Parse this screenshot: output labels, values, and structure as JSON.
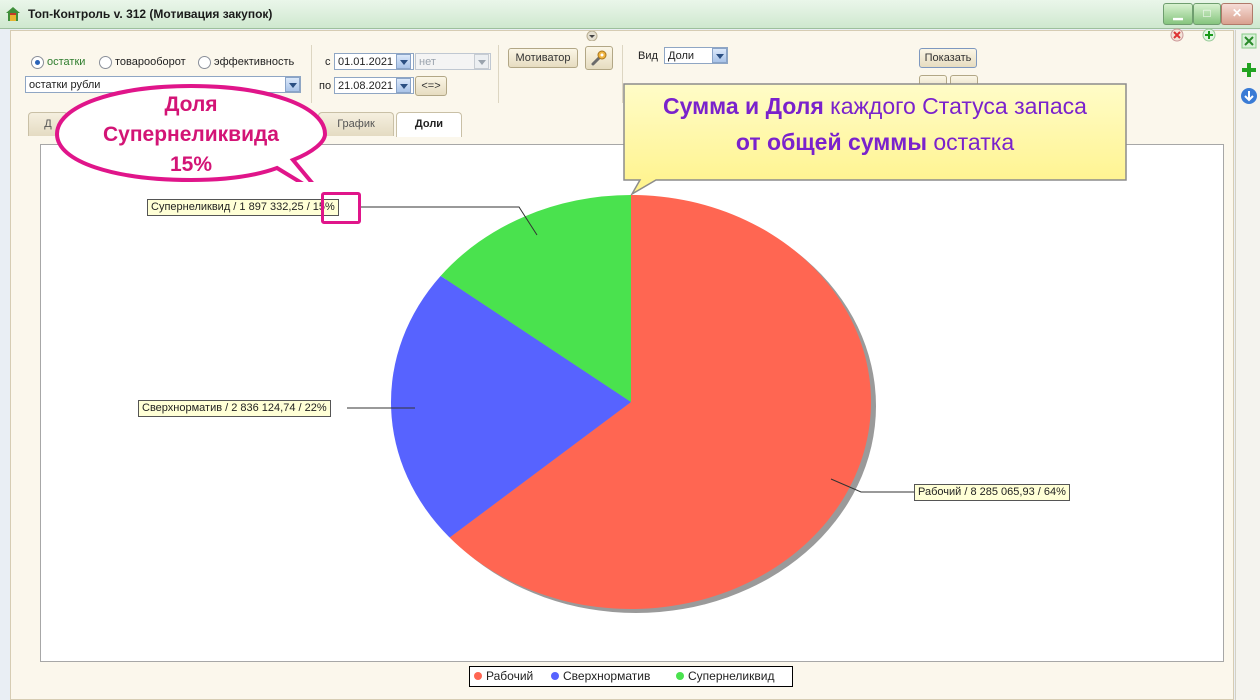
{
  "window": {
    "title": "Топ-Контроль v. 312 (Мотивация закупок)"
  },
  "toolbar": {
    "mode_options": [
      {
        "label": "остатки",
        "selected": true
      },
      {
        "label": "товарооборот",
        "selected": false
      },
      {
        "label": "эффективность",
        "selected": false
      }
    ],
    "measure_select": "остатки рубли",
    "date_from_label": "с",
    "date_from": "01.01.2021",
    "date_to_label": "по",
    "date_to": "21.08.2021",
    "extra_select": "нет",
    "swap_button": "<=>",
    "motivator_button": "Мотиватор",
    "view_label": "Вид",
    "view_select": "Доли",
    "show_button": "Показать"
  },
  "tabs": [
    {
      "label": "Д",
      "active": false
    },
    {
      "label": "График",
      "active": false
    },
    {
      "label": "Доли",
      "active": true
    }
  ],
  "chart_data": {
    "type": "pie",
    "slices": [
      {
        "name": "Рабочий",
        "value": 8285065.93,
        "percent": 64,
        "color": "#ff6652",
        "label": "Рабочий / 8 285 065,93 / 64%"
      },
      {
        "name": "Сверхнорматив",
        "value": 2836124.74,
        "percent": 22,
        "color": "#5763ff",
        "label": "Сверхнорматив / 2 836 124,74 / 22%"
      },
      {
        "name": "Супернеликвид",
        "value": 1897332.25,
        "percent": 15,
        "color": "#4ae24e",
        "label": "Супернеликвид / 1 897 332,25 / 15%"
      }
    ],
    "legend": [
      "Рабочий",
      "Сверхнорматив",
      "Супернеликвид"
    ],
    "legend_position": "bottom-center"
  },
  "annotations": {
    "pink_callout": [
      "Доля",
      "Супернеликвида",
      "15%"
    ],
    "yellow_callout": {
      "line1_bold": "Сумма и Доля",
      "line1_rest": "каждого Статуса запаса",
      "line2_bold": "от общей суммы",
      "line2_rest": "остатка"
    }
  },
  "colors": {
    "accent_pink": "#e0158a",
    "accent_purple": "#7a22cc",
    "callout_yellow": "#fff9a8"
  }
}
